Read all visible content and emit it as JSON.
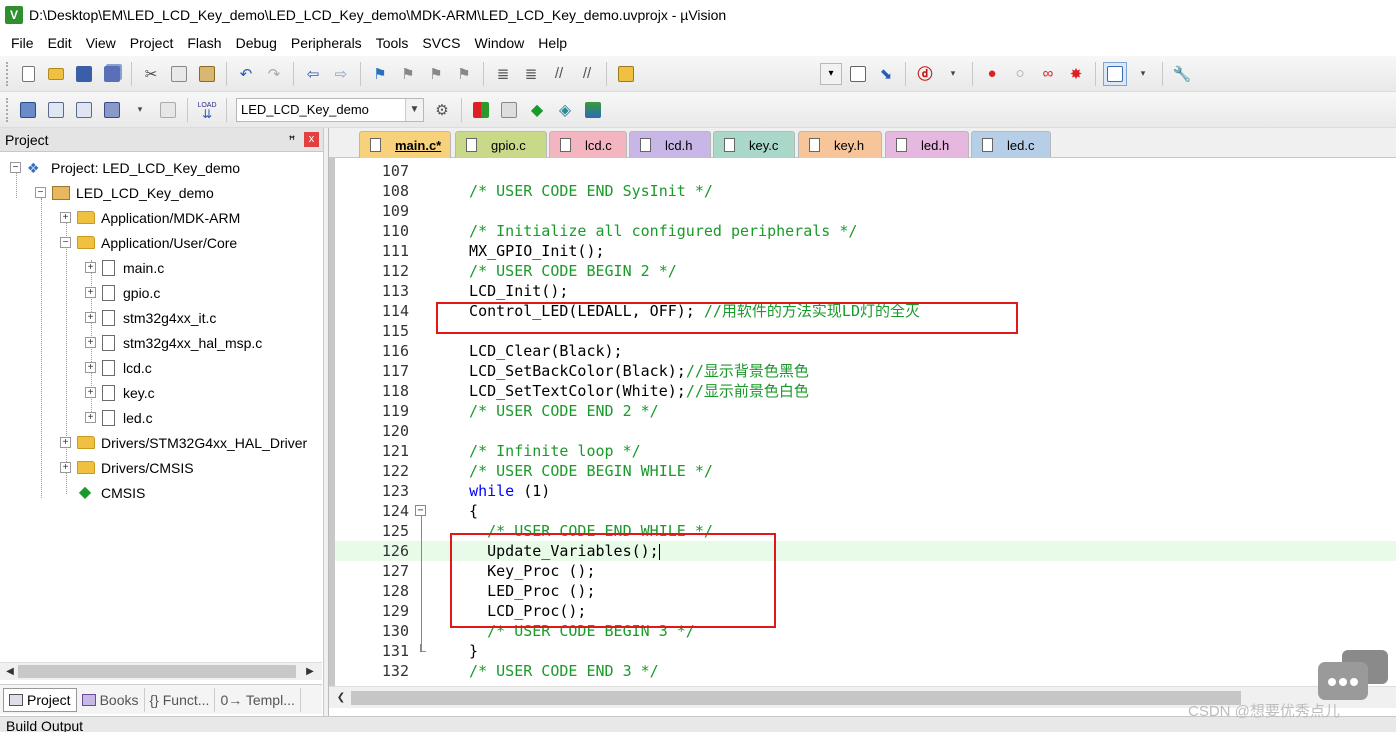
{
  "window": {
    "title": "D:\\Desktop\\EM\\LED_LCD_Key_demo\\LED_LCD_Key_demo\\MDK-ARM\\LED_LCD_Key_demo.uvprojx - µVision",
    "icon_letter": "V"
  },
  "menu": [
    "File",
    "Edit",
    "View",
    "Project",
    "Flash",
    "Debug",
    "Peripherals",
    "Tools",
    "SVCS",
    "Window",
    "Help"
  ],
  "toolbar": {
    "target_select": "LED_LCD_Key_demo",
    "load_label": "LOAD"
  },
  "project_panel": {
    "title": "Project",
    "pin_glyph": "ꟸ",
    "close_glyph": "x",
    "tree": [
      {
        "label": "Project: LED_LCD_Key_demo",
        "icon": "project-icon"
      },
      {
        "label": "LED_LCD_Key_demo",
        "icon": "target-icon"
      },
      {
        "label": "Application/MDK-ARM",
        "icon": "folder-icon"
      },
      {
        "label": "Application/User/Core",
        "icon": "folder-icon"
      },
      {
        "label": "main.c",
        "icon": "file-icon"
      },
      {
        "label": "gpio.c",
        "icon": "file-icon"
      },
      {
        "label": "stm32g4xx_it.c",
        "icon": "file-icon"
      },
      {
        "label": "stm32g4xx_hal_msp.c",
        "icon": "file-icon"
      },
      {
        "label": "lcd.c",
        "icon": "file-icon"
      },
      {
        "label": "key.c",
        "icon": "file-icon"
      },
      {
        "label": "led.c",
        "icon": "file-icon"
      },
      {
        "label": "Drivers/STM32G4xx_HAL_Driver",
        "icon": "folder-icon"
      },
      {
        "label": "Drivers/CMSIS",
        "icon": "folder-icon"
      },
      {
        "label": "CMSIS",
        "icon": "diamond-icon"
      }
    ],
    "bottom_tabs": [
      "Project",
      "Books",
      "{} Funct...",
      "0→ Templ..."
    ]
  },
  "editor": {
    "tabs": [
      {
        "label": "main.c*",
        "color": "#f7d27a",
        "active": true
      },
      {
        "label": "gpio.c",
        "color": "#c9d98a"
      },
      {
        "label": "lcd.c",
        "color": "#f3b6c0"
      },
      {
        "label": "lcd.h",
        "color": "#c8b7e6"
      },
      {
        "label": "key.c",
        "color": "#a9d7c9"
      },
      {
        "label": "key.h",
        "color": "#f6c59a"
      },
      {
        "label": "led.h",
        "color": "#e6b7df"
      },
      {
        "label": "led.c",
        "color": "#b7cfe6"
      }
    ],
    "lines": [
      {
        "n": "107",
        "segs": []
      },
      {
        "n": "108",
        "segs": [
          {
            "t": "  /* USER CODE END SysInit */",
            "c": "cmt"
          }
        ]
      },
      {
        "n": "109",
        "segs": []
      },
      {
        "n": "110",
        "segs": [
          {
            "t": "  /* Initialize all configured peripherals */",
            "c": "cmt"
          }
        ]
      },
      {
        "n": "111",
        "segs": [
          {
            "t": "  MX_GPIO_Init();",
            "c": ""
          }
        ]
      },
      {
        "n": "112",
        "segs": [
          {
            "t": "  /* USER CODE BEGIN 2 */",
            "c": "cmt"
          }
        ]
      },
      {
        "n": "113",
        "segs": [
          {
            "t": "  LCD_Init();",
            "c": ""
          }
        ]
      },
      {
        "n": "114",
        "segs": [
          {
            "t": "  Control_LED(LEDALL, OFF); ",
            "c": ""
          },
          {
            "t": "//用软件的方法实现LD灯的全灭",
            "c": "cmt"
          }
        ]
      },
      {
        "n": "115",
        "segs": []
      },
      {
        "n": "116",
        "segs": [
          {
            "t": "  LCD_Clear(Black);",
            "c": ""
          }
        ]
      },
      {
        "n": "117",
        "segs": [
          {
            "t": "  LCD_SetBackColor(Black);",
            "c": ""
          },
          {
            "t": "//显示背景色黑色",
            "c": "cmt"
          }
        ]
      },
      {
        "n": "118",
        "segs": [
          {
            "t": "  LCD_SetTextColor(White);",
            "c": ""
          },
          {
            "t": "//显示前景色白色",
            "c": "cmt"
          }
        ]
      },
      {
        "n": "119",
        "segs": [
          {
            "t": "  /* USER CODE END 2 */",
            "c": "cmt"
          }
        ]
      },
      {
        "n": "120",
        "segs": []
      },
      {
        "n": "121",
        "segs": [
          {
            "t": "  /* Infinite loop */",
            "c": "cmt"
          }
        ]
      },
      {
        "n": "122",
        "segs": [
          {
            "t": "  /* USER CODE BEGIN WHILE */",
            "c": "cmt"
          }
        ]
      },
      {
        "n": "123",
        "segs": [
          {
            "t": "  ",
            "c": ""
          },
          {
            "t": "while",
            "c": "kw"
          },
          {
            "t": " (1)",
            "c": ""
          }
        ]
      },
      {
        "n": "124",
        "segs": [
          {
            "t": "  {",
            "c": ""
          }
        ],
        "fold": "open"
      },
      {
        "n": "125",
        "segs": [
          {
            "t": "    /* USER CODE END WHILE */",
            "c": "cmt"
          }
        ]
      },
      {
        "n": "126",
        "segs": [
          {
            "t": "    Update_Variables();",
            "c": ""
          }
        ],
        "current": true
      },
      {
        "n": "127",
        "segs": [
          {
            "t": "    Key_Proc ();",
            "c": ""
          }
        ]
      },
      {
        "n": "128",
        "segs": [
          {
            "t": "    LED_Proc ();",
            "c": ""
          }
        ]
      },
      {
        "n": "129",
        "segs": [
          {
            "t": "    LCD_Proc();",
            "c": ""
          }
        ]
      },
      {
        "n": "130",
        "segs": [
          {
            "t": "    /* USER CODE BEGIN 3 */",
            "c": "cmt"
          }
        ]
      },
      {
        "n": "131",
        "segs": [
          {
            "t": "  }",
            "c": ""
          }
        ],
        "fold": "end"
      },
      {
        "n": "132",
        "segs": [
          {
            "t": "  /* USER CODE END 3 */",
            "c": "cmt"
          }
        ]
      }
    ]
  },
  "build_output": {
    "label": "Build Output"
  },
  "watermark": "CSDN @想要优秀点儿",
  "colors": {
    "comment": "#1a9a2a",
    "keyword": "#0000ff",
    "highlight_box": "#e01818",
    "current_line": "#e8fbe8"
  }
}
